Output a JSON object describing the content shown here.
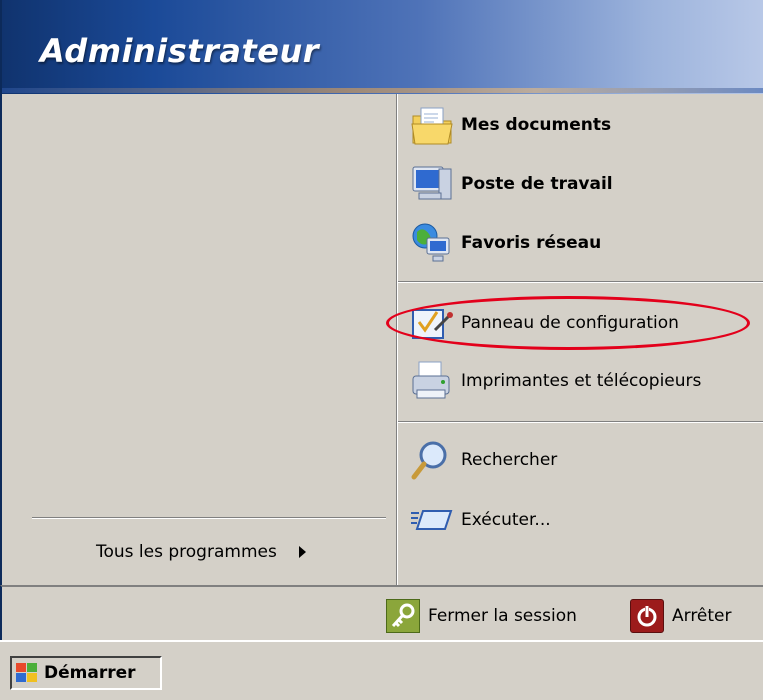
{
  "header": {
    "user_name": "Administrateur"
  },
  "left": {
    "all_programs_label": "Tous les programmes"
  },
  "right": {
    "items": [
      {
        "label": "Mes documents",
        "icon": "my-documents-icon"
      },
      {
        "label": "Poste de travail",
        "icon": "my-computer-icon"
      },
      {
        "label": "Favoris réseau",
        "icon": "network-places-icon"
      },
      {
        "label": "Panneau de configuration",
        "icon": "control-panel-icon"
      },
      {
        "label": "Imprimantes et télécopieurs",
        "icon": "printers-icon"
      },
      {
        "label": "Rechercher",
        "icon": "search-icon"
      },
      {
        "label": "Exécuter...",
        "icon": "run-icon"
      }
    ]
  },
  "footer": {
    "logoff_label": "Fermer la session",
    "shutdown_label": "Arrêter"
  },
  "taskbar": {
    "start_label": "Démarrer"
  },
  "colors": {
    "header_start": "#10336e",
    "header_end": "#b8c8e7",
    "panel_bg": "#d4d0c8",
    "highlight": "#e3001b"
  }
}
